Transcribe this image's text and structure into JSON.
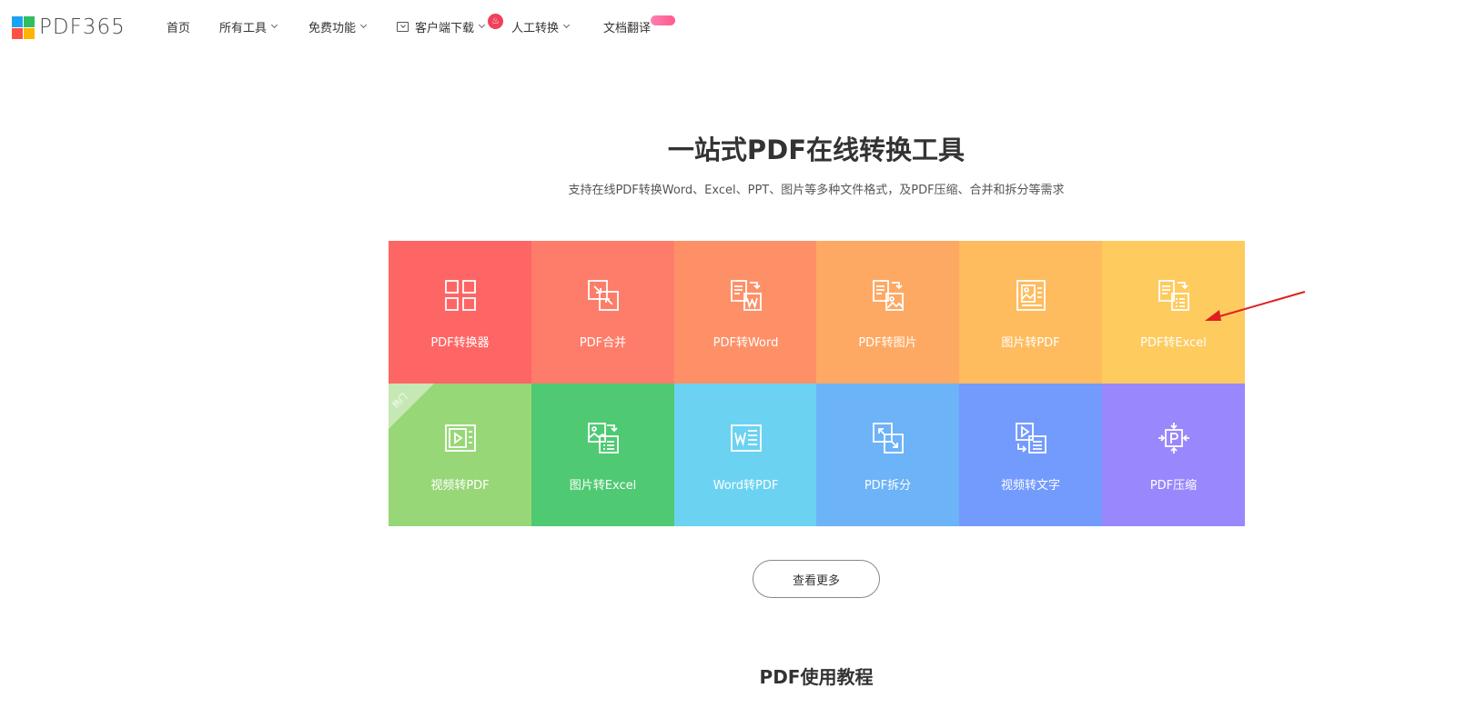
{
  "header": {
    "logo_text": "PDF365",
    "nav": {
      "home": "首页",
      "tools": "所有工具",
      "free": "免费功能",
      "client": "客户端下载",
      "manual": "人工转换",
      "translate": "文档翻译"
    }
  },
  "hero": {
    "title": "一站式PDF在线转换工具",
    "subtitle": "支持在线PDF转换Word、Excel、PPT、图片等多种文件格式，及PDF压缩、合并和拆分等需求"
  },
  "tools": [
    {
      "label": "PDF转换器",
      "color": "#fe6665",
      "icon": "grid-icon"
    },
    {
      "label": "PDF合并",
      "color": "#fe7d6a",
      "icon": "merge-icon"
    },
    {
      "label": "PDF转Word",
      "color": "#fe9068",
      "icon": "pdf-to-word-icon"
    },
    {
      "label": "PDF转图片",
      "color": "#fea963",
      "icon": "pdf-to-image-icon"
    },
    {
      "label": "图片转PDF",
      "color": "#febc5e",
      "icon": "image-to-pdf-icon"
    },
    {
      "label": "PDF转Excel",
      "color": "#fecb5f",
      "icon": "pdf-to-excel-icon"
    },
    {
      "label": "视频转PDF",
      "color": "#98d777",
      "icon": "video-to-pdf-icon",
      "badge": "热门"
    },
    {
      "label": "图片转Excel",
      "color": "#4fca72",
      "icon": "image-to-excel-icon"
    },
    {
      "label": "Word转PDF",
      "color": "#6cd2f2",
      "icon": "word-to-pdf-icon"
    },
    {
      "label": "PDF拆分",
      "color": "#6cb3f7",
      "icon": "split-icon"
    },
    {
      "label": "视频转文字",
      "color": "#739bfe",
      "icon": "video-to-text-icon"
    },
    {
      "label": "PDF压缩",
      "color": "#9987fe",
      "icon": "compress-icon"
    }
  ],
  "more_button": "查看更多",
  "section_title": "PDF使用教程",
  "annotation_color": "#e02020"
}
